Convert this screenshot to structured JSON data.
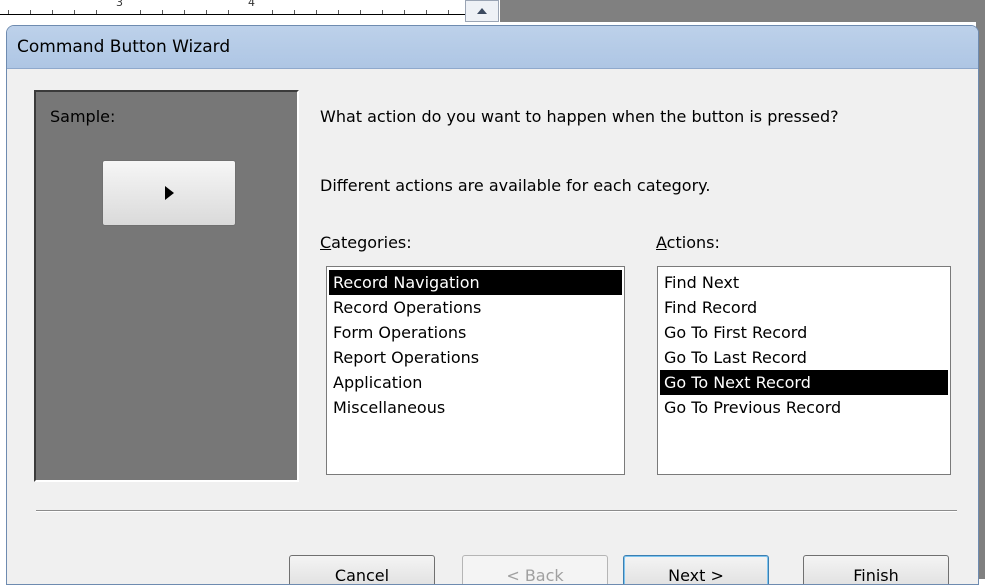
{
  "ruler": {
    "numbers": [
      "3",
      "4"
    ]
  },
  "dialog": {
    "title": "Command Button Wizard",
    "sample_label": "Sample:",
    "question": "What action do you want to happen when the button is pressed?",
    "info": "Different actions are available for each category.",
    "categories_label": "Categories:",
    "actions_label": "Actions:",
    "categories": [
      {
        "label": "Record Navigation",
        "selected": true
      },
      {
        "label": "Record Operations",
        "selected": false
      },
      {
        "label": "Form Operations",
        "selected": false
      },
      {
        "label": "Report Operations",
        "selected": false
      },
      {
        "label": "Application",
        "selected": false
      },
      {
        "label": "Miscellaneous",
        "selected": false
      }
    ],
    "actions": [
      {
        "label": "Find Next",
        "selected": false
      },
      {
        "label": "Find Record",
        "selected": false
      },
      {
        "label": "Go To First Record",
        "selected": false
      },
      {
        "label": "Go To Last Record",
        "selected": false
      },
      {
        "label": "Go To Next Record",
        "selected": true
      },
      {
        "label": "Go To Previous Record",
        "selected": false
      }
    ],
    "buttons": {
      "cancel": "Cancel",
      "back": "< Back",
      "next": "Next >",
      "finish": "Finish"
    }
  },
  "sample_icon": "play-right-icon",
  "colors": {
    "selection": "#000000",
    "title_bar": "#b7cde8",
    "sample_bg": "#777777"
  }
}
